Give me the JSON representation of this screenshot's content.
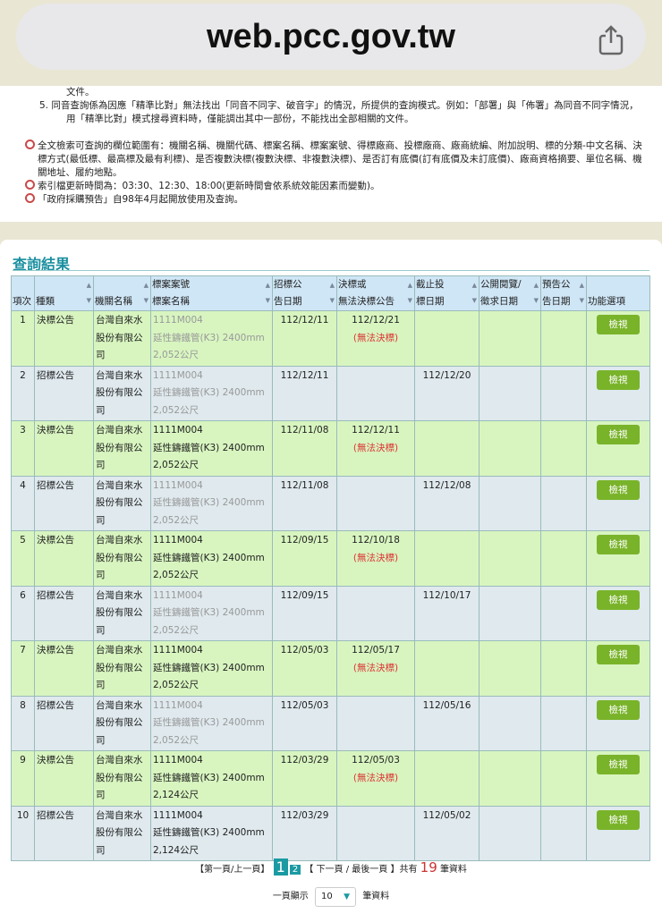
{
  "browser": {
    "url": "web.pcc.gov.tw"
  },
  "notes": {
    "cont": "文件。",
    "item5": "5.  同音查詢係為因應「精準比對」無法找出「同音不同字、破音字」的情況，所提供的查詢模式。例如：「部署」與「佈署」為同音不同字情況，",
    "item5b": "用「精準比對」模式搜尋資料時，僅能調出其中一部份，不能找出全部相關的文件。",
    "s1": "全文檢索可查詢的欄位範圍有：機關名稱、機關代碼、標案名稱、標案案號、得標廠商、投標廠商、廠商統編、附加說明、標的分類-中文名稱、決標方式(最低標、最高標及最有利標)、是否複數決標(複數決標、非複數決標)、是否訂有底價(訂有底價及未訂底價)、廠商資格摘要、單位名稱、機關地址、履約地點。",
    "s2": "索引檔更新時間為：03:30、12:30、18:00(更新時間會依系統效能因素而變動)。",
    "s3": "「政府採購預告」自98年4月起開放使用及查詢。"
  },
  "results": {
    "title": "查詢結果",
    "headers": {
      "no": "項次",
      "type": "種類",
      "org": "機關名稱",
      "case1": "標案案號",
      "case2": "標案名稱",
      "pub1": "招標公",
      "pub2": "告日期",
      "award1": "決標或",
      "award2": "無法決標公告",
      "dead1": "截止投",
      "dead2": "標日期",
      "open1": "公開閱覽/",
      "open2": "徵求日期",
      "pre1": "預告公",
      "pre2": "告日期",
      "func": "功能選項"
    },
    "rows": [
      {
        "no": "1",
        "type": "決標公告",
        "org": "台灣自來水股份有限公司",
        "id": "1111M004",
        "name": "延性鑄鐵管(K3) 2400mm",
        "qty": "2,052公尺",
        "pub": "112/12/11",
        "award": "112/12/21",
        "note": "(無法決標)",
        "dead": "",
        "btn": "檢視"
      },
      {
        "no": "2",
        "type": "招標公告",
        "org": "台灣自來水股份有限公司",
        "id": "1111M004",
        "name": "延性鑄鐵管(K3) 2400mm",
        "qty": "2,052公尺",
        "pub": "112/12/11",
        "award": "",
        "note": "",
        "dead": "112/12/20",
        "btn": "檢視"
      },
      {
        "no": "3",
        "type": "決標公告",
        "org": "台灣自來水股份有限公司",
        "id": "1111M004",
        "name": "延性鑄鐵管(K3) 2400mm",
        "qty": "2,052公尺",
        "pub": "112/11/08",
        "award": "112/12/11",
        "note": "(無法決標)",
        "dead": "",
        "btn": "檢視"
      },
      {
        "no": "4",
        "type": "招標公告",
        "org": "台灣自來水股份有限公司",
        "id": "1111M004",
        "name": "延性鑄鐵管(K3) 2400mm",
        "qty": "2,052公尺",
        "pub": "112/11/08",
        "award": "",
        "note": "",
        "dead": "112/12/08",
        "btn": "檢視"
      },
      {
        "no": "5",
        "type": "決標公告",
        "org": "台灣自來水股份有限公司",
        "id": "1111M004",
        "name": "延性鑄鐵管(K3) 2400mm",
        "qty": "2,052公尺",
        "pub": "112/09/15",
        "award": "112/10/18",
        "note": "(無法決標)",
        "dead": "",
        "btn": "檢視"
      },
      {
        "no": "6",
        "type": "招標公告",
        "org": "台灣自來水股份有限公司",
        "id": "1111M004",
        "name": "延性鑄鐵管(K3) 2400mm",
        "qty": "2,052公尺",
        "pub": "112/09/15",
        "award": "",
        "note": "",
        "dead": "112/10/17",
        "btn": "檢視"
      },
      {
        "no": "7",
        "type": "決標公告",
        "org": "台灣自來水股份有限公司",
        "id": "1111M004",
        "name": "延性鑄鐵管(K3) 2400mm",
        "qty": "2,052公尺",
        "pub": "112/05/03",
        "award": "112/05/17",
        "note": "(無法決標)",
        "dead": "",
        "btn": "檢視"
      },
      {
        "no": "8",
        "type": "招標公告",
        "org": "台灣自來水股份有限公司",
        "id": "1111M004",
        "name": "延性鑄鐵管(K3) 2400mm",
        "qty": "2,052公尺",
        "pub": "112/05/03",
        "award": "",
        "note": "",
        "dead": "112/05/16",
        "btn": "檢視"
      },
      {
        "no": "9",
        "type": "決標公告",
        "org": "台灣自來水股份有限公司",
        "id": "1111M004",
        "name": "延性鑄鐵管(K3) 2400mm",
        "qty": "2,124公尺",
        "pub": "112/03/29",
        "award": "112/05/03",
        "note": "(無法決標)",
        "dead": "",
        "btn": "檢視"
      },
      {
        "no": "10",
        "type": "招標公告",
        "org": "台灣自來水股份有限公司",
        "id": "1111M004",
        "name": "延性鑄鐵管(K3) 2400mm",
        "qty": "2,124公尺",
        "pub": "112/03/29",
        "award": "",
        "note": "",
        "dead": "112/05/02",
        "btn": "檢視"
      }
    ]
  },
  "pager": {
    "first": "【第一頁/上一頁】",
    "p1": "1",
    "p2": "2",
    "next": "【 下一頁  / 最後一頁 】共有",
    "count": "19",
    "unit": "筆資料",
    "per_label": "一頁顯示",
    "per_value": "10",
    "per_unit": "筆資料"
  }
}
